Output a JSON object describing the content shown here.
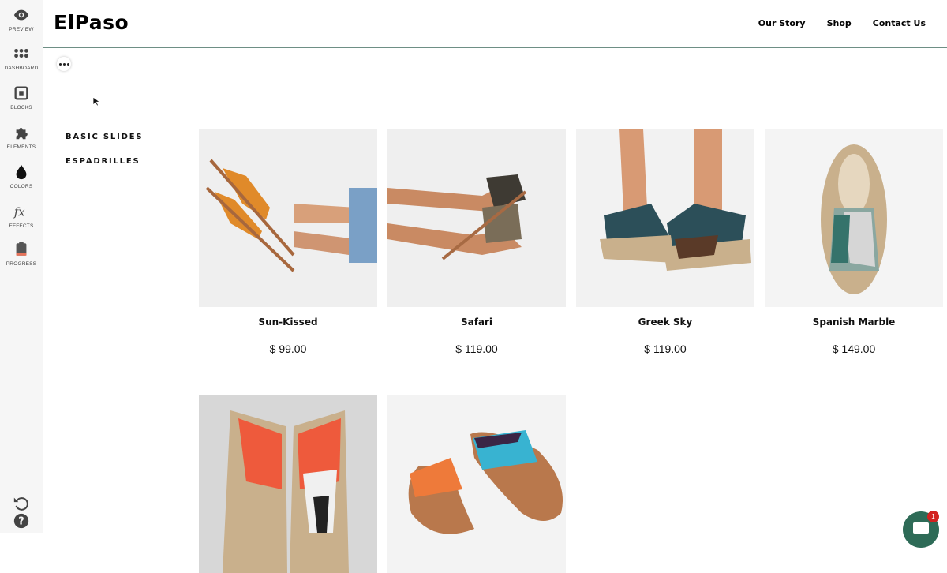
{
  "toolbar": {
    "items": [
      {
        "label": "PREVIEW",
        "icon": "eye-icon"
      },
      {
        "label": "DASHBOARD",
        "icon": "dashboard-icon"
      },
      {
        "label": "BLOCKS",
        "icon": "blocks-icon"
      },
      {
        "label": "ELEMENTS",
        "icon": "puzzle-icon"
      },
      {
        "label": "COLORS",
        "icon": "droplet-icon"
      },
      {
        "label": "EFFECTS",
        "icon": "fx-icon"
      },
      {
        "label": "PROGRESS",
        "icon": "clipboard-icon"
      }
    ],
    "bottom": [
      {
        "icon": "undo-icon"
      },
      {
        "icon": "help-icon"
      }
    ]
  },
  "header": {
    "logo": "ElPaso",
    "nav": [
      "Our Story",
      "Shop",
      "Contact Us"
    ]
  },
  "categories": [
    "BASIC SLIDES",
    "ESPADRILLES"
  ],
  "products": [
    {
      "name": "Sun-Kissed",
      "price": "$ 99.00"
    },
    {
      "name": "Safari",
      "price": "$ 119.00"
    },
    {
      "name": "Greek Sky",
      "price": "$ 119.00"
    },
    {
      "name": "Spanish Marble",
      "price": "$ 149.00"
    },
    {
      "name": "",
      "price": ""
    },
    {
      "name": "",
      "price": ""
    }
  ],
  "chat": {
    "badge": "1"
  },
  "colors": {
    "accent": "#2e6b57",
    "badge": "#d2221f"
  }
}
